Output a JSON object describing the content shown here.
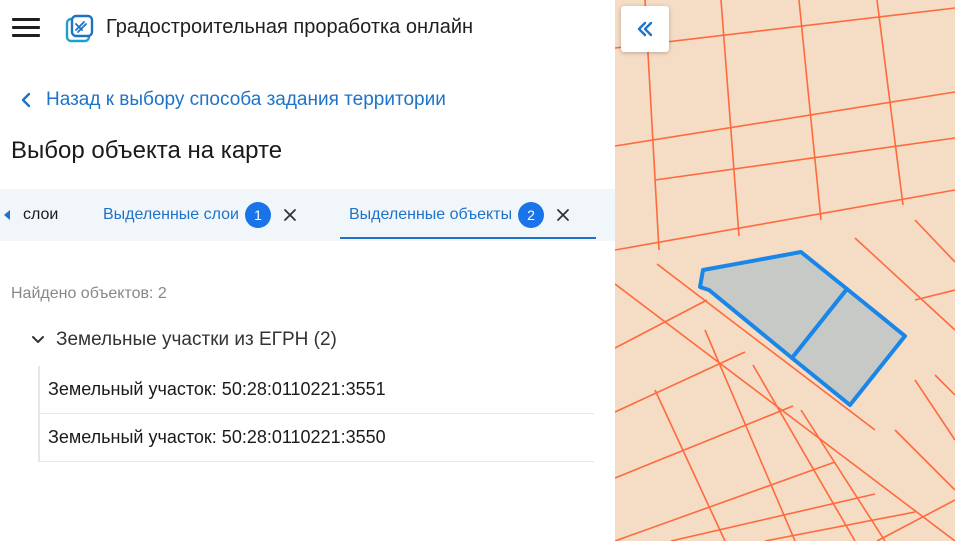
{
  "header": {
    "app_title": "Градостроительная проработка онлайн",
    "menu_icon": "hamburger-menu-icon",
    "logo_icon": "app-logo-icon"
  },
  "nav": {
    "back_label": "Назад к выбору способа задания территории"
  },
  "page": {
    "title": "Выбор объекта на карте"
  },
  "tabs": [
    {
      "label": "слои",
      "badge": null
    },
    {
      "label": "Выделенные слои",
      "badge": "1"
    },
    {
      "label": "Выделенные объекты",
      "badge": "2",
      "active": true
    }
  ],
  "results": {
    "found_label": "Найдено объектов: 2",
    "group_label": "Земельные участки из ЕГРН (2)",
    "items": [
      {
        "label": "Земельный участок: 50:28:0110221:3551"
      },
      {
        "label": "Земельный участок: 50:28:0110221:3550"
      }
    ]
  },
  "colors": {
    "accent": "#1e73c9",
    "badge": "#1a73e8",
    "map_background": "#f5dcc5",
    "parcel_border": "#ff6a3d",
    "selection_stroke": "#1a87e8",
    "selection_fill": "#c7c9c6"
  },
  "map": {
    "collapse_icon": "double-chevron-left-icon"
  }
}
